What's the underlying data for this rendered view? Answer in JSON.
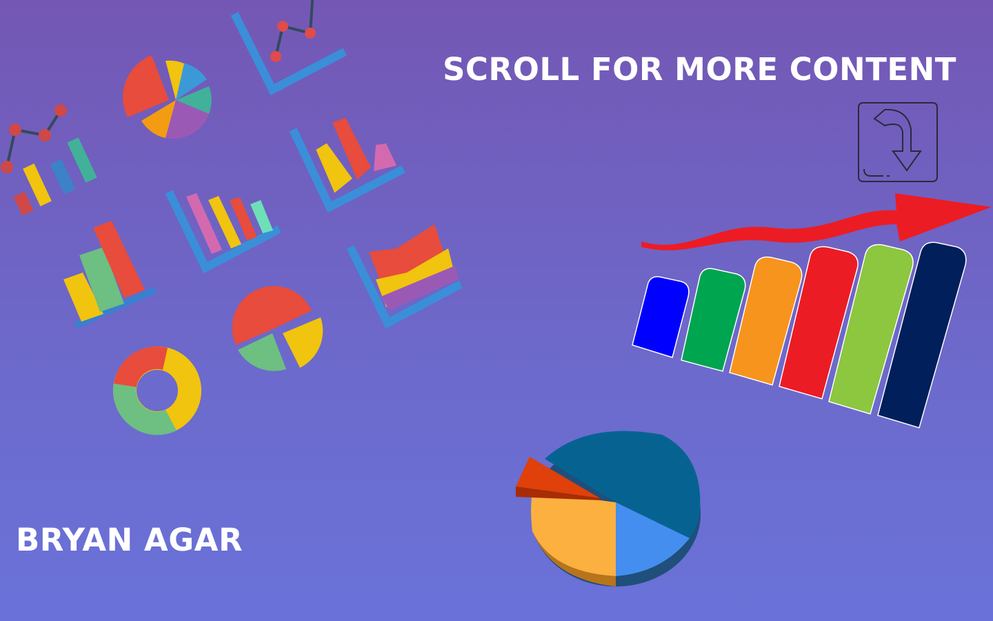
{
  "header": {
    "scroll_prompt": "SCROLL FOR MORE CONTENT"
  },
  "footer": {
    "author_name": "BRYAN AGAR"
  },
  "icons": {
    "scroll": "curved-arrow-down-icon"
  },
  "colors": {
    "bg_top": "#7457b4",
    "bg_bottom": "#6a72d9",
    "text": "#ffffff"
  }
}
